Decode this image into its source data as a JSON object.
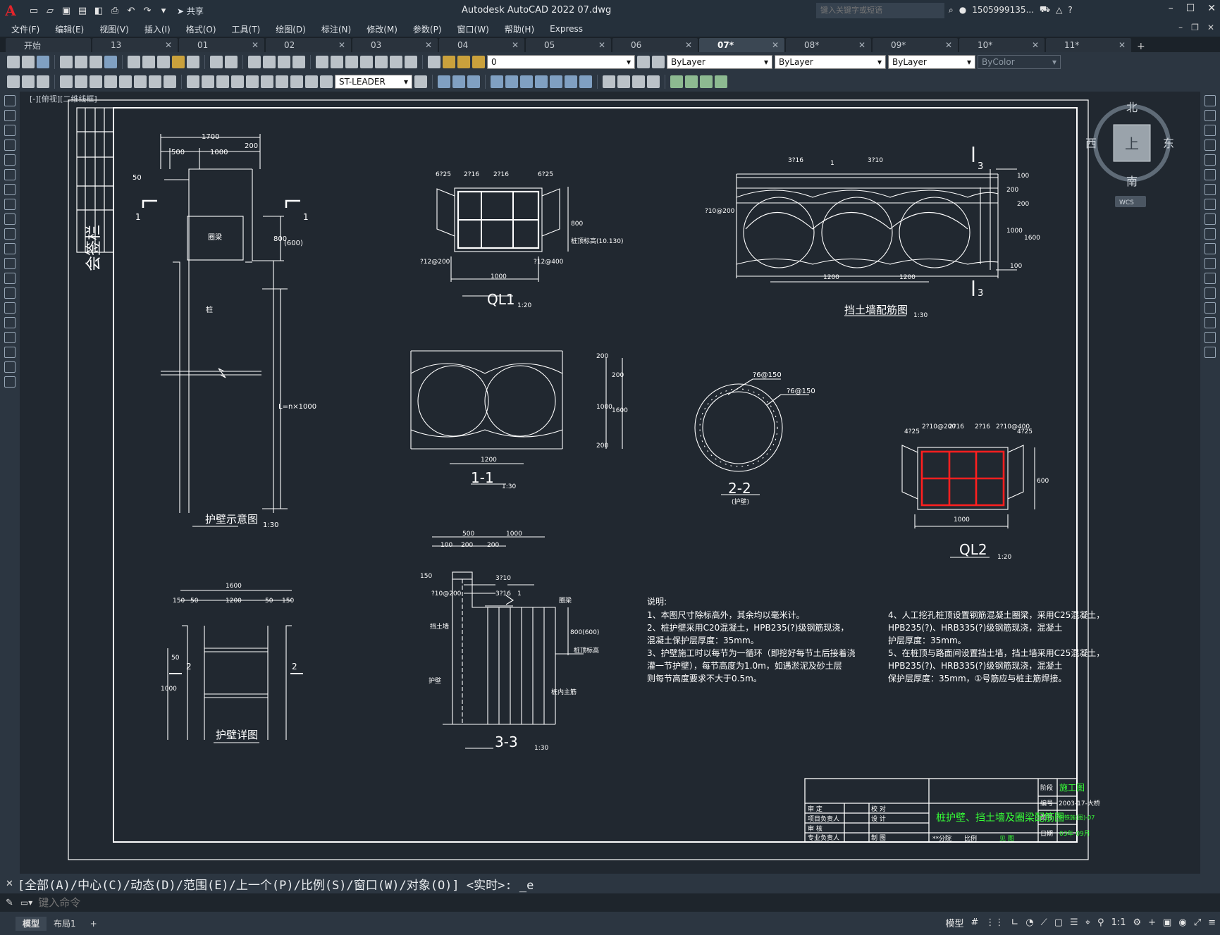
{
  "app": {
    "title": "Autodesk AutoCAD 2022    07.dwg",
    "logo": "A",
    "share": "共享",
    "search_placeholder": "键入关键字或短语",
    "user": "1505999135...",
    "help": "?"
  },
  "menu": [
    "文件(F)",
    "编辑(E)",
    "视图(V)",
    "插入(I)",
    "格式(O)",
    "工具(T)",
    "绘图(D)",
    "标注(N)",
    "修改(M)",
    "参数(P)",
    "窗口(W)",
    "帮助(H)",
    "Express"
  ],
  "tabs": [
    {
      "label": "开始",
      "active": false
    },
    {
      "label": "13",
      "active": false
    },
    {
      "label": "01",
      "active": false
    },
    {
      "label": "02",
      "active": false
    },
    {
      "label": "03",
      "active": false
    },
    {
      "label": "04",
      "active": false
    },
    {
      "label": "05",
      "active": false
    },
    {
      "label": "06",
      "active": false
    },
    {
      "label": "07*",
      "active": true
    },
    {
      "label": "08*",
      "active": false
    },
    {
      "label": "09*",
      "active": false
    },
    {
      "label": "10*",
      "active": false
    },
    {
      "label": "11*",
      "active": false
    }
  ],
  "toolbar": {
    "layer": "0",
    "color": "ByLayer",
    "linetype": "ByLayer",
    "lineweight": "ByLayer",
    "plotstyle": "ByColor",
    "mleader_style": "ST-LEADER"
  },
  "viewport": {
    "label": "[-][俯视][二维线框]"
  },
  "viewcube": {
    "north": "北",
    "south": "南",
    "east": "东",
    "west": "西",
    "top": "上",
    "wcs": "WCS"
  },
  "drawing": {
    "sign_box": "会签栏",
    "d1": {
      "title": "护壁示意图",
      "scale": "1:30",
      "dims": [
        "1700",
        "500",
        "1000",
        "200",
        "50",
        "800",
        "(600)",
        "L=n×1000"
      ],
      "labels": [
        "圈梁",
        "桩"
      ],
      "marks": [
        "1",
        "1"
      ]
    },
    "d2": {
      "title": "QL1",
      "scale": "1:20",
      "dims": [
        "6?25",
        "2?16",
        "2?16",
        "6?25",
        "?12@200",
        "?12@400",
        "1000",
        "800"
      ],
      "labels": [
        "桩顶标高(10.130)"
      ]
    },
    "d3": {
      "title": "挡土墙配筋图",
      "scale": "1:30",
      "dims": [
        "3?16",
        "3?10",
        "?10@200",
        "1200",
        "1200",
        "100",
        "200",
        "200",
        "1000",
        "1600",
        "100"
      ],
      "marks": [
        "3",
        "3",
        "1"
      ]
    },
    "d4": {
      "title": "1-1",
      "scale": "1:30",
      "dims": [
        "200",
        "200",
        "1000",
        "1600",
        "200",
        "1200"
      ]
    },
    "d5": {
      "title": "2-2",
      "subtitle": "(护壁)",
      "dims": [
        "?6@150",
        "?6@150"
      ]
    },
    "d6": {
      "title": "QL2",
      "scale": "1:20",
      "dims": [
        "4?25",
        "2?10@200",
        "2?16",
        "2?16",
        "2?10@400",
        "4?25",
        "600",
        "1000"
      ]
    },
    "d7": {
      "title": "护壁详图",
      "dims": [
        "1600",
        "150",
        "50",
        "1200",
        "50",
        "150",
        "50",
        "1000"
      ],
      "marks": [
        "2",
        "2"
      ]
    },
    "d8": {
      "title": "3-3",
      "scale": "1:30",
      "dims": [
        "500",
        "1000",
        "100",
        "200",
        "200",
        "150",
        "3?10",
        "?10@200",
        "3?16",
        "800(600)"
      ],
      "labels": [
        "圈梁",
        "挡土墙",
        "桩顶标高",
        "护壁",
        "桩内主筋"
      ],
      "marks": [
        "1"
      ]
    },
    "notes": {
      "heading": "说明:",
      "left": [
        "1、本图尺寸除标高外，其余均以毫米计。",
        "2、桩护壁采用C20混凝土，HPB235(?)级钢筋现浇，",
        "   混凝土保护层厚度：35mm。",
        "3、护壁施工时以每节为一循环（即挖好每节土后接着浇",
        "   灌一节护壁），每节高度为1.0m，如遇淤泥及砂土层",
        "   则每节高度要求不大于0.5m。"
      ],
      "right": [
        "4、人工挖孔桩顶设置钢筋混凝土圈梁，采用C25混凝土，",
        "   HPB235(?)、HRB335(?)级钢筋现浇，混凝土",
        "   护层厚度：35mm。",
        "5、在桩顶与路面间设置挡土墙，挡土墙采用C25混凝土，",
        "   HPB235(?)、HRB335(?)级钢筋现浇，混凝土",
        "   保护层厚度：35mm，①号筋应与桩主筋焊接。"
      ]
    },
    "titleblock": {
      "stage_label": "阶段",
      "stage": "施工图",
      "no_label": "编号",
      "no": "2003-17-大桥",
      "sheet_label": "图号",
      "sheet": "中铁施(图)-07",
      "date_label": "日期",
      "date": "03年 09月",
      "title": "桩护壁、挡土墙及圈梁配筋图",
      "rows": [
        [
          "审 定",
          "",
          "校 对",
          ""
        ],
        [
          "项目负责人",
          "",
          "设 计",
          ""
        ],
        [
          "审 核",
          "",
          "",
          ""
        ],
        [
          "专业负责人",
          "",
          "制 图",
          ""
        ]
      ],
      "footer": [
        "**分院",
        "比例",
        "见 图"
      ]
    }
  },
  "cmd": {
    "history": "[全部(A)/中心(C)/动态(D)/范围(E)/上一个(P)/比例(S)/窗口(W)/对象(O)] <实时>: _e",
    "placeholder": "键入命令"
  },
  "status": {
    "tabs": [
      "模型",
      "布局1"
    ],
    "model": "模型",
    "scale": "1:1"
  }
}
